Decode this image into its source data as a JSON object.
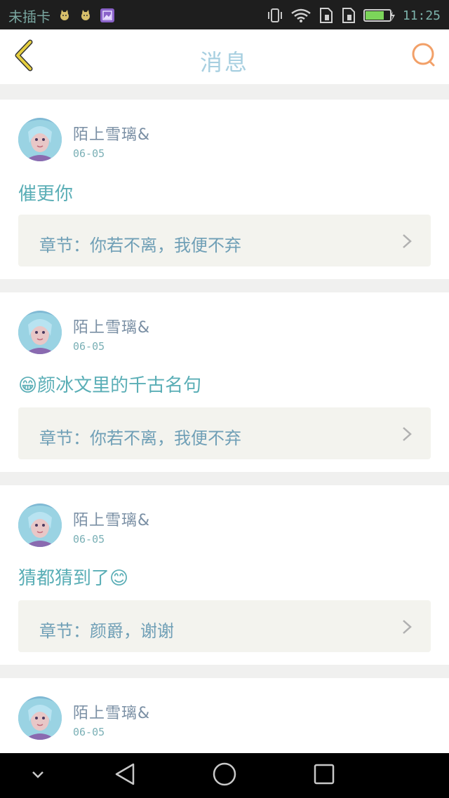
{
  "status_bar": {
    "carrier": "未插卡",
    "time": "11:25",
    "icons": [
      "cat-notification-icon",
      "cat-notification-icon",
      "gallery-icon",
      "vibrate-icon",
      "wifi-icon",
      "sim-icon",
      "sim-icon",
      "battery-icon"
    ],
    "battery_level": 0.75,
    "colors": {
      "background": "#1e1e1e",
      "text": "#79a6a0",
      "battery": "#7cd55a"
    }
  },
  "header": {
    "title": "消息",
    "back_icon": "chevron-left-icon",
    "search_icon": "search-icon",
    "colors": {
      "title": "#a7cfe0",
      "back": "#e6cf3f",
      "search": "#f2a068"
    }
  },
  "messages": [
    {
      "username": "陌上雪璃&",
      "date": "06-05",
      "content": "催更你",
      "chapter_label": "章节：你若不离，我便不弃",
      "avatar_icon": "avatar-image"
    },
    {
      "username": "陌上雪璃&",
      "date": "06-05",
      "content": "😁颜冰文里的千古名句",
      "chapter_label": "章节：你若不离，我便不弃",
      "avatar_icon": "avatar-image"
    },
    {
      "username": "陌上雪璃&",
      "date": "06-05",
      "content": "猜都猜到了😊",
      "chapter_label": "章节：颜爵，谢谢",
      "avatar_icon": "avatar-image"
    },
    {
      "username": "陌上雪璃&",
      "date": "06-05",
      "content": "",
      "chapter_label": "",
      "avatar_icon": "avatar-image"
    }
  ],
  "nav_bar": {
    "items": [
      "chevron-down-icon",
      "back-triangle-icon",
      "home-circle-icon",
      "recents-square-icon"
    ]
  }
}
